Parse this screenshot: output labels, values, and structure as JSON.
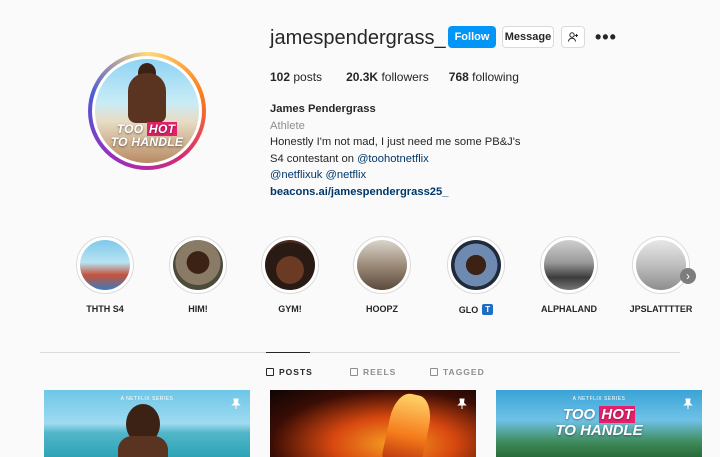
{
  "profile": {
    "username": "jamespendergrass_",
    "follow_label": "Follow",
    "message_label": "Message",
    "stats": {
      "posts_count": "102",
      "posts_label": "posts",
      "followers_count": "20.3K",
      "followers_label": "followers",
      "following_count": "768",
      "following_label": "following"
    },
    "bio": {
      "name": "James Pendergrass",
      "category": "Athlete",
      "line1": "Honestly I'm not mad, I just need me some PB&J's",
      "line2_text": "S4 contestant on ",
      "line2_link": "@toohotnetflix",
      "line3_link1": "@netflixuk",
      "line3_link2": "@netflix",
      "website": "beacons.ai/jamespendergrass25_"
    },
    "avatar_logo_line1": "TOO",
    "avatar_logo_hot": "HOT",
    "avatar_logo_line2": "TO HANDLE"
  },
  "highlights": [
    {
      "label": "THTH S4"
    },
    {
      "label": "HIM!"
    },
    {
      "label": "GYM!"
    },
    {
      "label": "HOOPZ"
    },
    {
      "label": "GLO",
      "badge": "T"
    },
    {
      "label": "ALPHALAND"
    },
    {
      "label": "JPSLATTTTER"
    }
  ],
  "tabs": {
    "posts": "POSTS",
    "reels": "REELS",
    "tagged": "TAGGED"
  },
  "posts": {
    "netflix_tag": "A NETFLIX SERIES",
    "post3_line1": "TOO",
    "post3_hot": "HOT",
    "post3_line2": "TO HANDLE"
  },
  "colors": {
    "follow_button": "#0095f6",
    "link": "#00376b",
    "secondary_text": "#8e8e8e"
  }
}
